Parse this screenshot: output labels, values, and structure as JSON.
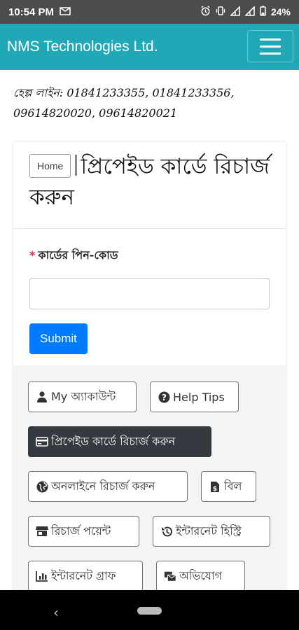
{
  "status": {
    "time": "10:54 PM",
    "battery": "24%"
  },
  "navbar": {
    "brand": "NMS Technologies Ltd."
  },
  "helpline": {
    "text": "হেল্প লাইন: 01841233355, 01841233356, 09614820020, 09614820021"
  },
  "breadcrumb": {
    "home": "Home"
  },
  "page": {
    "title": "প্রিপেইড কার্ডে রিচার্জ করুন"
  },
  "form": {
    "required_mark": "*",
    "pin_label": "কার্ডের পিন-কোড",
    "pin_value": "",
    "submit_label": "Submit"
  },
  "menu": {
    "my_account": "My অ্যাকাউন্ট",
    "help_tips": "Help Tips",
    "prepaid_recharge": "প্রিপেইড কার্ডে রিচার্জ করুন",
    "online_recharge": "অনলাইনে রিচার্জ করুন",
    "bill": "বিল",
    "recharge_payment": "রিচার্জ পয়েন্ট",
    "internet_history": "ইন্টারনেট হিস্ট্রি",
    "internet_graph": "ইন্টারনেট গ্রাফ",
    "complaint": "অভিযোগ"
  },
  "colors": {
    "navbar": "#21a8b6",
    "primary": "#007bff",
    "dark": "#343a40"
  }
}
